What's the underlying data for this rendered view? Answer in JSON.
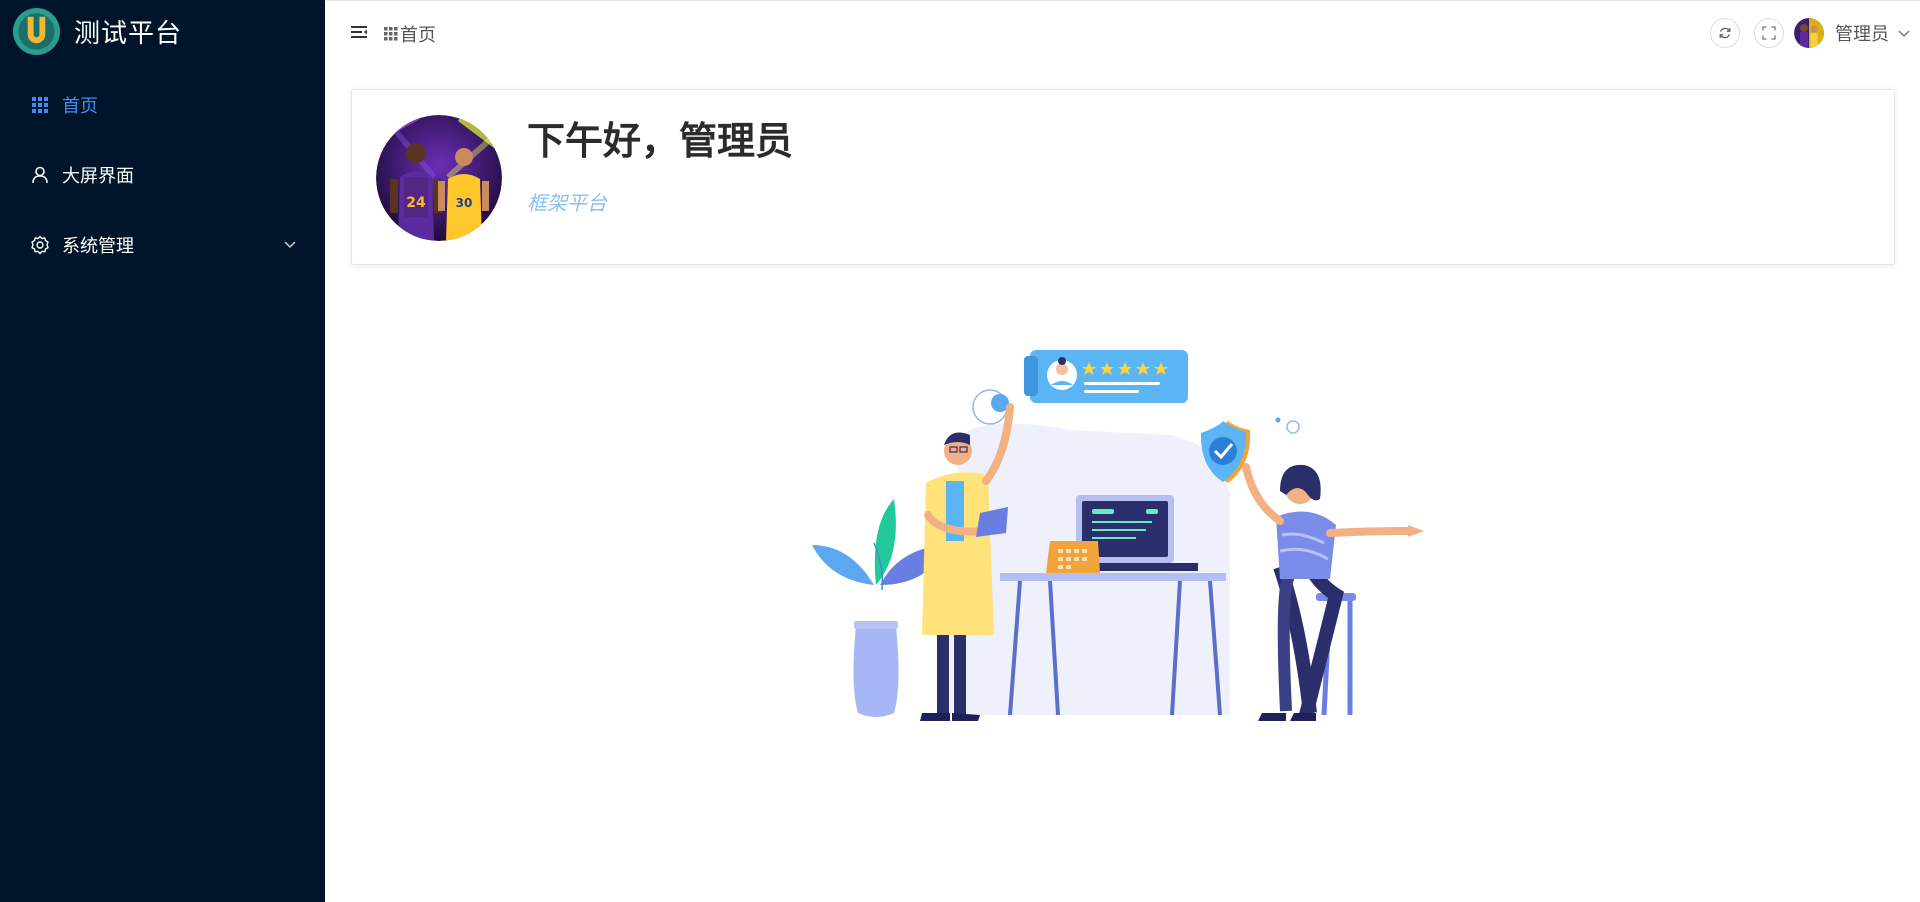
{
  "sidebar": {
    "brand": {
      "title": "测试平台",
      "logo": "u-logo"
    },
    "items": [
      {
        "label": "首页",
        "icon": "grid-icon",
        "active": true
      },
      {
        "label": "大屏界面",
        "icon": "user-icon",
        "active": false
      },
      {
        "label": "系统管理",
        "icon": "gear-icon",
        "active": false,
        "expandable": true
      }
    ]
  },
  "header": {
    "breadcrumb": {
      "label": "首页",
      "icon": "grid-icon"
    },
    "actions": [
      "refresh-icon",
      "fullscreen-icon"
    ],
    "user": {
      "name": "管理员"
    }
  },
  "welcome": {
    "greeting": "下午好，管理员",
    "subtitle": "框架平台"
  },
  "colors": {
    "sidebar_bg": "#001529",
    "active": "#3f8ef7",
    "subtitle": "#86c2ef"
  }
}
